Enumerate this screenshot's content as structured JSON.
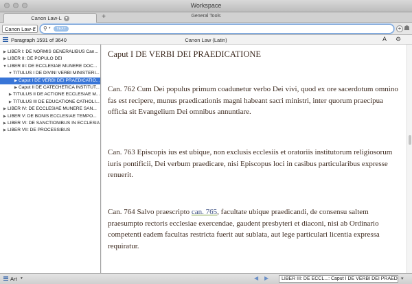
{
  "window": {
    "title": "Workspace"
  },
  "tabs": {
    "active_tab": "Canon Law-L",
    "general_tools": "General Tools",
    "add": "+"
  },
  "search": {
    "scope": "Canon Law-L",
    "token": "TEXT"
  },
  "info": {
    "paragraph": "Paragraph 1591 of 3640",
    "resource": "Canon Law (Latin)",
    "font_size": "A",
    "settings": "⚙"
  },
  "tree": [
    {
      "label": "LIBER I: DE NORMIS GENERALIBUS Can...",
      "tri": "▶",
      "indent": 0
    },
    {
      "label": "LIBER II: DE POPULO DEI",
      "tri": "▶",
      "indent": 0
    },
    {
      "label": "LIBER III: DE ECCLESIAE MUNERE DOC...",
      "tri": "▼",
      "indent": 0
    },
    {
      "label": "TITULUS I DE DIVINI VERBI MINISTERI...",
      "tri": "▼",
      "indent": 1
    },
    {
      "label": "Caput I DE VERBI DEI PRAEDICATIO...",
      "tri": "▶",
      "indent": 2,
      "selected": true
    },
    {
      "label": "Caput II DE CATECHETICA INSTITUT...",
      "tri": "▶",
      "indent": 2
    },
    {
      "label": "TITULUS II DE ACTIONE ECCLESIAE M...",
      "tri": "▶",
      "indent": 1
    },
    {
      "label": "TITULUS III DE EDUCATIONE CATHOLI...",
      "tri": "▶",
      "indent": 1
    },
    {
      "label": "LIBER IV: DE ECCLESIAE MUNERE SAN...",
      "tri": "▶",
      "indent": 0
    },
    {
      "label": "LIBER V: DE BONIS ECCLESIAE TEMPO...",
      "tri": "▶",
      "indent": 0
    },
    {
      "label": "LIBER VI: DE SANCTIONIBUS IN ECCLESIA",
      "tri": "▶",
      "indent": 0
    },
    {
      "label": "LIBER VII: DE PROCESSIBUS",
      "tri": "▶",
      "indent": 0
    }
  ],
  "content": {
    "heading": "Caput I DE VERBI DEI PRAEDICATIONE",
    "canon_762": "Can. 762  Cum Dei populus primum coadunetur verbo Dei vivi, quod ex ore sacerdotum omnino fas est recipere, munus praedicationis magni habeant sacri ministri, inter quorum praecipua officia sit Evangelium Dei omnibus annuntiare.",
    "canon_763": "Can. 763  Episcopis ius est ubique, non exclusis ecclesiis et oratoriis institutorum religiosorum iuris pontificii, Dei verbum praedicare, nisi Episcopus loci in casibus particularibus expresse renuerit.",
    "canon_764_a": "Can. 764  Salvo praescripto ",
    "canon_764_link": "can. 765",
    "canon_764_b": ", facultate ubique praedicandi, de consensu saltem praesumpto rectoris ecclesiae exercendae, gaudent presbyteri et diaconi, nisi ab Ordinario competenti eadem facultas restricta fuerit aut sublata, aut lege particulari licentia expressa requiratur."
  },
  "bottom": {
    "art": "Art",
    "breadcrumb": "LIBER III: DE ECCL...: Caput I DE VERBI DEI PRAEDICA..."
  }
}
